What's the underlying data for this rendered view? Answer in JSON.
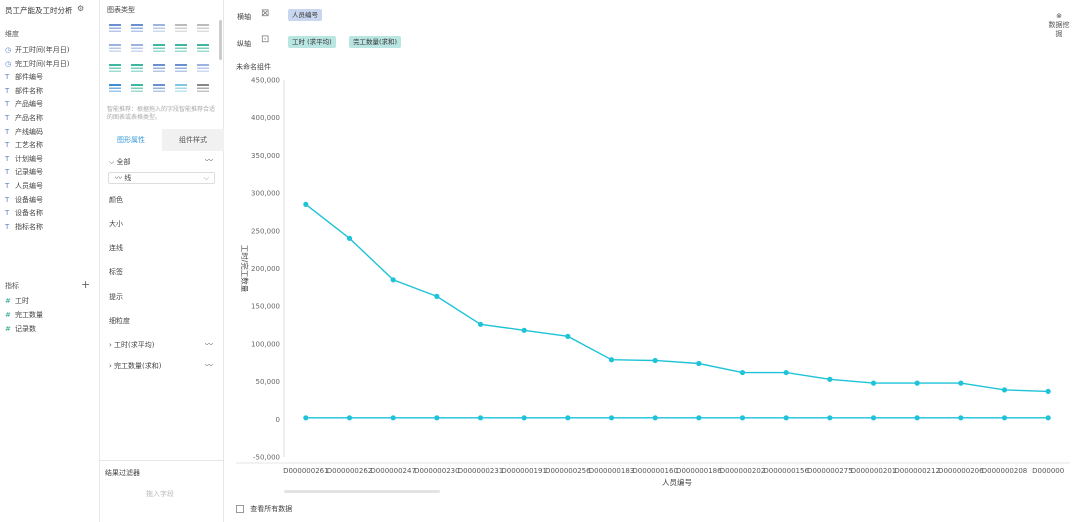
{
  "dataset": {
    "title": "员工产能及工时分析"
  },
  "dimensions": {
    "title": "维度",
    "items": [
      {
        "type": "time",
        "label": "开工时间(年月日)"
      },
      {
        "type": "time",
        "label": "完工时间(年月日)"
      },
      {
        "type": "text",
        "label": "部件编号"
      },
      {
        "type": "text",
        "label": "部件名称"
      },
      {
        "type": "text",
        "label": "产品编号"
      },
      {
        "type": "text",
        "label": "产品名称"
      },
      {
        "type": "text",
        "label": "产线编码"
      },
      {
        "type": "text",
        "label": "工艺名称"
      },
      {
        "type": "text",
        "label": "计划编号"
      },
      {
        "type": "text",
        "label": "记录编号"
      },
      {
        "type": "text",
        "label": "人员编号"
      },
      {
        "type": "text",
        "label": "设备编号"
      },
      {
        "type": "text",
        "label": "设备名称"
      },
      {
        "type": "text",
        "label": "指标名称"
      }
    ]
  },
  "measures": {
    "title": "指标",
    "items": [
      {
        "type": "#",
        "label": "工时"
      },
      {
        "type": "#",
        "label": "完工数量"
      },
      {
        "type": "#",
        "label": "记录数"
      }
    ]
  },
  "chart_types": {
    "title": "图表类型",
    "hint": "智能推荐：根据拖入的字段智能推荐合适的图表或表格类型。"
  },
  "tabs": {
    "props": "图形属性",
    "style": "组件样式"
  },
  "props": {
    "all": "全部",
    "mark_type": "线",
    "color": "颜色",
    "size": "大小",
    "connect": "连线",
    "label": "标签",
    "tooltip": "提示",
    "granularity": "细粒度",
    "series1": "工时(求平均)",
    "series2": "完工数量(求和)"
  },
  "result_filter": {
    "title": "结果过滤器",
    "drop": "拖入字段"
  },
  "axes": {
    "x_label": "横轴",
    "x_field": "人员编号",
    "y_label": "纵轴",
    "y_field_1": "工时 (求平均)",
    "y_field_2": "完工数量(求和)"
  },
  "mining": {
    "label": "数据挖掘"
  },
  "chart_title": "未命名组件",
  "show_all": "查看所有数据",
  "colors": {
    "line": "#1ec3d8",
    "accent": "#3a9bd9"
  },
  "chart_data": {
    "type": "line",
    "xlabel": "人员编号",
    "ylabel": "工时/完工数量",
    "ylim": [
      -50000,
      450000
    ],
    "yticks": [
      -50000,
      0,
      50000,
      100000,
      150000,
      200000,
      250000,
      300000,
      350000,
      400000,
      450000
    ],
    "ytick_labels": [
      "-50,000",
      "0",
      "50,000",
      "100,000",
      "150,000",
      "200,000",
      "250,000",
      "300,000",
      "350,000",
      "400,000",
      "450,000"
    ],
    "categories": [
      "D000000261",
      "D000000262",
      "D000000247",
      "D000000230",
      "D000000231",
      "D000000191",
      "D000000256",
      "D000000183",
      "D000000160",
      "D000000186",
      "D000000202",
      "D000000156",
      "D000000275",
      "D000000201",
      "D000000212",
      "D000000206",
      "D000000208",
      "D000000"
    ],
    "series": [
      {
        "values": [
          285000,
          240000,
          185000,
          163000,
          126000,
          118000,
          110000,
          79000,
          78000,
          74000,
          62000,
          62000,
          53000,
          48000,
          48000,
          48000,
          39000,
          37000
        ]
      },
      {
        "values": [
          2000,
          2000,
          2000,
          2000,
          2000,
          2000,
          2000,
          2000,
          2000,
          2000,
          2000,
          2000,
          2000,
          2000,
          2000,
          2000,
          2000,
          2000
        ]
      }
    ]
  }
}
